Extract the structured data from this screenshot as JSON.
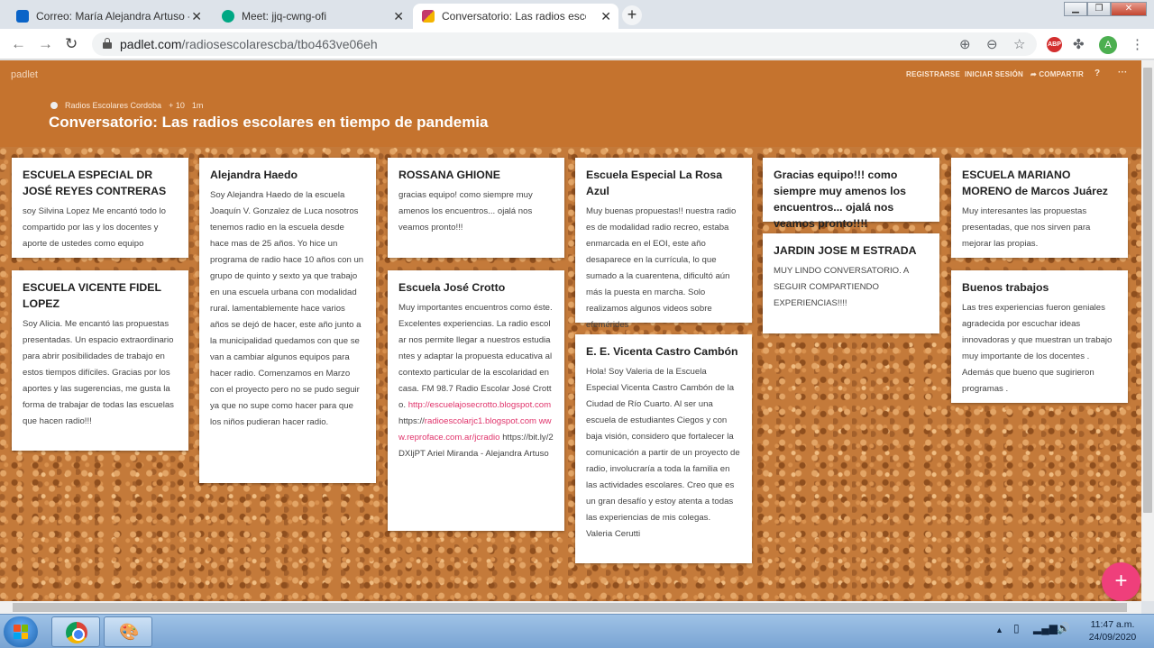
{
  "browser": {
    "tabs": [
      {
        "label": "Correo: María Alejandra Artuso -",
        "active": false,
        "favicon_color": "#0a64c8"
      },
      {
        "label": "Meet: jjq-cwng-ofi",
        "active": false,
        "favicon_color": "#00a884"
      },
      {
        "label": "Conversatorio: Las radios escolar",
        "active": true,
        "favicon_color": "#c3386b"
      }
    ],
    "new_tab": "+",
    "url_host": "padlet.com",
    "url_path": "/radiosescolarescba/tbo463ve06eh",
    "abp_label": "ABP",
    "avatar_letter": "A"
  },
  "padlet": {
    "brand": "padlet",
    "nav": {
      "register": "REGISTRARSE",
      "login": "INICIAR SESIÓN",
      "share": "COMPARTIR"
    },
    "author": "Radios Escolares Cordoba",
    "score": "+ 10",
    "age": "1m",
    "title": "Conversatorio: Las radios escolares en tiempo de pandemia",
    "fab": "+",
    "accent": "#c5732e"
  },
  "cards": [
    {
      "title": "ESCUELA ESPECIAL DR JOSÉ REYES CONTRERAS",
      "body": "soy Silvina Lopez Me encantó todo lo compartido por las y los docentes y aporte de ustedes como equipo"
    },
    {
      "title": "ESCUELA VICENTE FIDEL LOPEZ",
      "body": "Soy Alicia. Me encantó las propuestas presentadas. Un espacio extraordinario para abrir posibilidades de trabajo en estos tiempos difíciles. Gracias por los aportes y las sugerencias, me gusta la forma de trabajar de todas las escuelas que hacen radio!!!"
    },
    {
      "title": "Alejandra Haedo",
      "body": "Soy Alejandra Haedo  de la escuela Joaquín V. Gonzalez de Luca nosotros tenemos radio en la escuela desde hace mas de 25 años. Yo hice un programa de radio hace 10 años con un grupo de quinto y sexto ya que trabajo en una escuela urbana con modalidad rural. lamentablemente hace varios años se dejó de hacer, este año junto a la municipalidad quedamos con que se van a cambiar algunos equipos para hacer radio. Comenzamos en Marzo con el proyecto pero no se pudo seguir ya que no supe como hacer para que los niños pudieran hacer radio."
    },
    {
      "title": "ROSSANA GHIONE",
      "body": "gracias  equipo! como siempre muy amenos los encuentros... ojalá nos veamos pronto!!!"
    },
    {
      "title": "Escuela José Crotto",
      "body_pre": "Muy importantes encuentros como éste. Excelentes experiencias.  La radio escolar nos permite llegar a nuestros estudiantes y adaptar la propuesta educativa al contexto particular de la escolaridad en casa. FM 98.7 Radio Escolar José Crotto.",
      "link1": "http://escuelajosecrotto.blogspot.com",
      "link2_prefix": "https://",
      "link2": "radioescolarjc1.blogspot.com  www.reproface.com.ar/jcradio",
      "body_post": "https://bit.ly/2DXljPT               Ariel Miranda - Alejandra Artuso"
    },
    {
      "title": "Escuela Especial La Rosa Azul",
      "body": "Muy buenas propuestas!! nuestra radio es de modalidad radio recreo, estaba enmarcada en el EOI, este año desaparece en la currícula,  lo que sumado a la cuarentena, dificultó aún más la puesta en marcha. Solo realizamos algunos videos sobre efemérides"
    },
    {
      "title": "E. E. Vicenta Castro Cambón",
      "body": "Hola! Soy Valeria de la Escuela Especial Vicenta Castro Cambón de la Ciudad de Río Cuarto. Al ser una escuela de estudiantes Ciegos y con baja visión, considero que fortalecer la comunicación a partir de un proyecto de radio, involucraría a toda la familia en las actividades escolares. Creo que es un gran desafío y estoy atenta a todas las experiencias de mis colegas.\nValeria Cerutti"
    },
    {
      "title": "Gracias equipo!!! como siempre muy amenos los encuentros... ojalá nos veamos pronto!!!!",
      "body": ""
    },
    {
      "title": "JARDIN JOSE M ESTRADA",
      "body": "MUY LINDO CONVERSATORIO. A SEGUIR COMPARTIENDO EXPERIENCIAS!!!!"
    },
    {
      "title": "ESCUELA MARIANO MORENO de Marcos Juárez",
      "body": "Muy interesantes las propuestas presentadas, que nos sirven para mejorar las propias."
    },
    {
      "title": "Buenos trabajos",
      "body": "Las tres experiencias fueron geniales agradecida por escuchar ideas innovadoras y que muestran un trabajo muy importante de los docentes . Además que bueno que sugirieron  programas ."
    }
  ],
  "taskbar": {
    "time": "11:47 a.m.",
    "date": "24/09/2020"
  }
}
